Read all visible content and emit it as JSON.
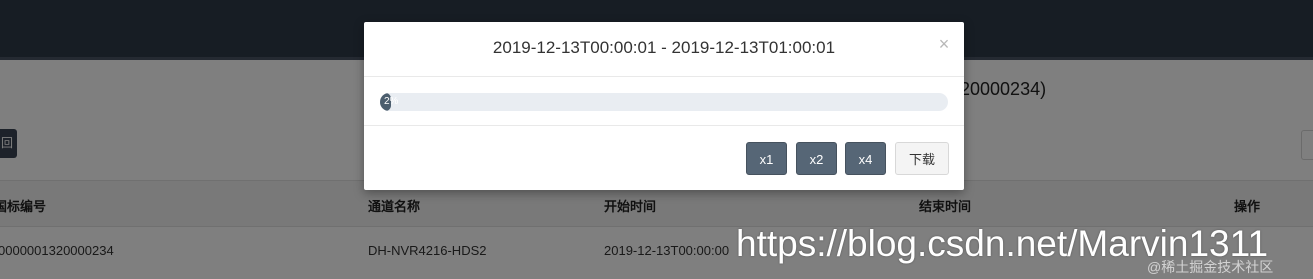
{
  "background": {
    "title_tail": "20000234)",
    "back_button_label": "回",
    "table": {
      "headers": [
        "国标编号",
        "通道名称",
        "开始时间",
        "结束时间",
        "操作"
      ],
      "row": [
        "0000001320000234",
        "DH-NVR4216-HDS2",
        "2019-12-13T00:00:00",
        "",
        ""
      ]
    }
  },
  "modal": {
    "title": "2019-12-13T00:00:01 - 2019-12-13T01:00:01",
    "close_glyph": "×",
    "progress": {
      "value_percent": 2,
      "label": "2%"
    },
    "buttons": {
      "speed_1": "x1",
      "speed_2": "x2",
      "speed_4": "x4",
      "download": "下载"
    }
  },
  "watermark": {
    "url": "https://blog.csdn.net/Marvin1311",
    "sub": "@稀土掘金技术社区"
  },
  "colors": {
    "topbar": "#2f3a49",
    "button_dark": "#566676",
    "progress_fill": "#4c5e6e",
    "progress_track": "#e9edf2"
  }
}
